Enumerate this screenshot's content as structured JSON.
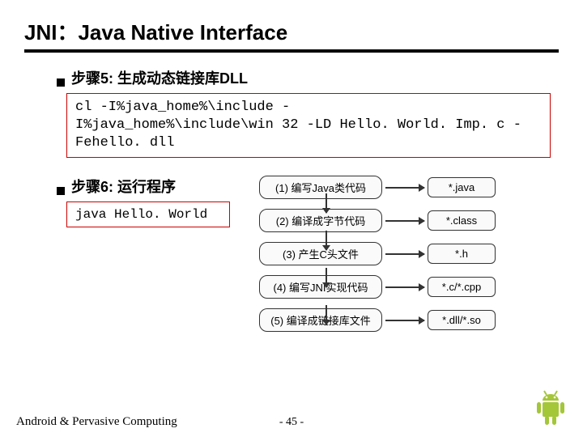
{
  "title": "JNI：Java Native Interface",
  "step5": {
    "label": "步骤5: 生成动态链接库DLL"
  },
  "code1": {
    "line1": "cl -I%java_home%\\include -",
    "line2": "I%java_home%\\include\\win 32 -LD Hello. World. Imp. c -",
    "line3a": "Fe",
    "line3b": "hello. dll"
  },
  "step6": {
    "label": "步骤6: 运行程序"
  },
  "code2": "java Hello. World",
  "diagram": {
    "rows": [
      {
        "left": "(1) 编写Java类代码",
        "right": "*.java"
      },
      {
        "left": "(2) 编译成字节代码",
        "right": "*.class"
      },
      {
        "left": "(3) 产生C头文件",
        "right": "*.h"
      },
      {
        "left": "(4) 编写JNI实现代码",
        "right": "*.c/*.cpp"
      },
      {
        "left": "(5) 编译成链接库文件",
        "right": "*.dll/*.so"
      }
    ]
  },
  "footer": {
    "left": "Android & Pervasive Computing",
    "page": "- 45 -"
  }
}
